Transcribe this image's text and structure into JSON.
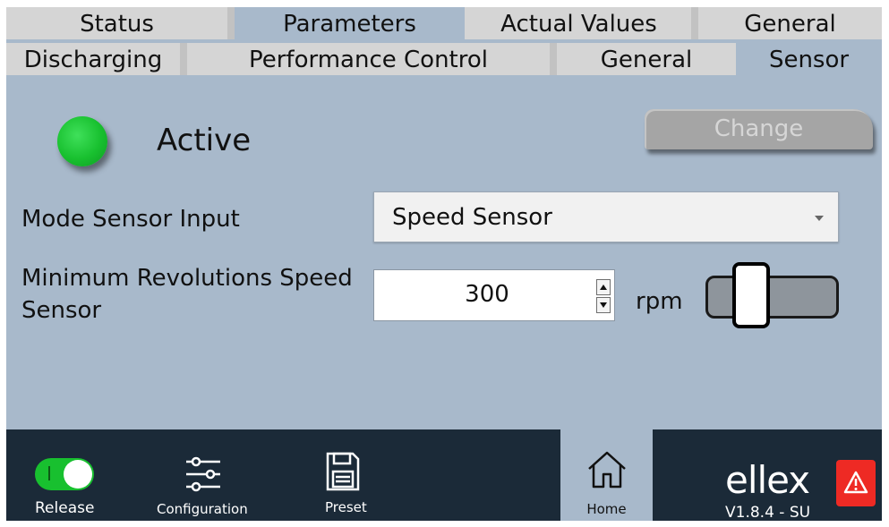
{
  "tabs_row1": [
    {
      "label": "Status",
      "selected": false
    },
    {
      "label": "Parameters",
      "selected": true
    },
    {
      "label": "Actual Values",
      "selected": false
    },
    {
      "label": "General",
      "selected": false
    }
  ],
  "tabs_row2": [
    {
      "label": "Discharging",
      "selected": false
    },
    {
      "label": "Performance Control",
      "selected": false
    },
    {
      "label": "General",
      "selected": false
    },
    {
      "label": "Sensor",
      "selected": true
    }
  ],
  "status": {
    "label": "Active",
    "led_color": "#18c02f"
  },
  "change_button": {
    "label": "Change",
    "enabled": false
  },
  "mode_sensor_input": {
    "label": "Mode Sensor Input",
    "value": "Speed Sensor"
  },
  "min_revolutions": {
    "label": "Minimum Revolutions Speed Sensor",
    "value": "300",
    "unit": "rpm"
  },
  "bottom_nav": {
    "release": {
      "label": "Release",
      "toggle_on": true,
      "toggle_text": "I"
    },
    "configuration": {
      "label": "Configuration"
    },
    "preset": {
      "label": "Preset"
    },
    "home": {
      "label": "Home"
    }
  },
  "brand": {
    "logo": "ellex",
    "version": "V1.8.4 - SU"
  },
  "colors": {
    "background": "#a8b9cb",
    "bottom_bar": "#1b2a38",
    "accent_green": "#18c02f",
    "alert_red": "#ee2a24"
  }
}
